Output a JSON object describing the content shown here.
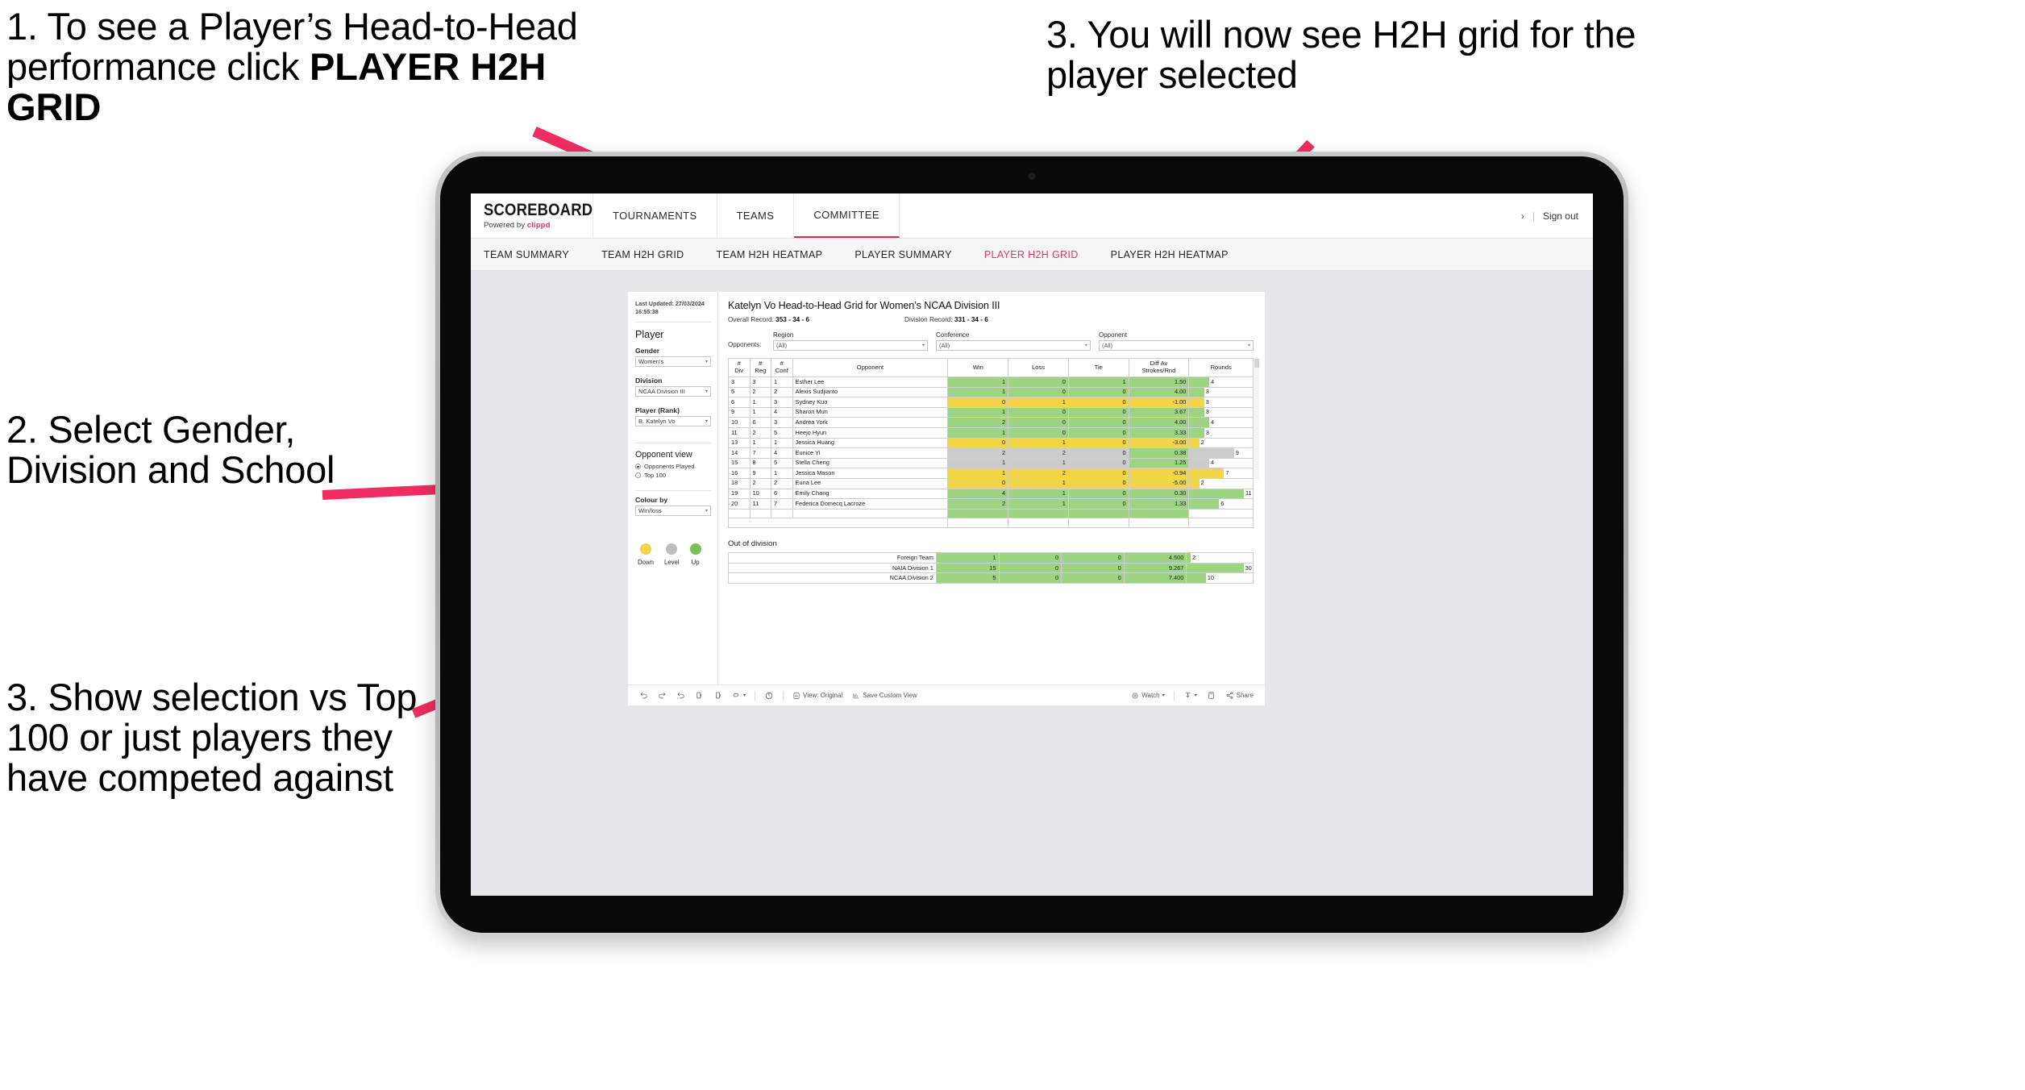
{
  "annotations": {
    "step1_plain": "1. To see a Player’s Head-to-Head performance click ",
    "step1_bold": "PLAYER H2H GRID",
    "step2": "3. You will now see H2H grid for the player selected",
    "step3": "2. Select Gender, Division and School",
    "step4": "3. Show selection vs Top 100 or just players they have competed against"
  },
  "brand": {
    "name": "SCOREBOARD",
    "powered_prefix": "Powered by ",
    "powered_name": "clippd"
  },
  "topnav": {
    "items": [
      {
        "label": "TOURNAMENTS",
        "active": false
      },
      {
        "label": "TEAMS",
        "active": false
      },
      {
        "label": "COMMITTEE",
        "active": true
      }
    ],
    "chevron": "›",
    "separator": "|",
    "sign_out": "Sign out"
  },
  "subnav": {
    "items": [
      {
        "label": "TEAM SUMMARY",
        "active": false
      },
      {
        "label": "TEAM H2H GRID",
        "active": false
      },
      {
        "label": "TEAM H2H HEATMAP",
        "active": false
      },
      {
        "label": "PLAYER SUMMARY",
        "active": false
      },
      {
        "label": "PLAYER H2H GRID",
        "active": true
      },
      {
        "label": "PLAYER H2H HEATMAP",
        "active": false
      }
    ],
    "active_color": "#e8336d"
  },
  "sidebar": {
    "last_updated": "Last Updated: 27/03/2024 16:55:38",
    "player_heading": "Player",
    "gender": {
      "label": "Gender",
      "value": "Women's"
    },
    "division": {
      "label": "Division",
      "value": "NCAA Division III"
    },
    "player_rank": {
      "label": "Player (Rank)",
      "value": "B. Katelyn Vo"
    },
    "opponent_view": {
      "heading": "Opponent view",
      "options": [
        {
          "label": "Opponents Played",
          "selected": true
        },
        {
          "label": "Top 100",
          "selected": false
        }
      ]
    },
    "colour_by": {
      "label": "Colour by",
      "value": "Win/loss"
    },
    "legend": [
      {
        "label": "Down",
        "color": "#f2d449"
      },
      {
        "label": "Level",
        "color": "#bdbdbd"
      },
      {
        "label": "Up",
        "color": "#76c151"
      }
    ]
  },
  "main": {
    "title": "Katelyn Vo Head-to-Head Grid for Women’s NCAA Division III",
    "overall_record_label": "Overall Record: ",
    "overall_record_value": "353 - 34 - 6",
    "division_record_label": "Division Record: ",
    "division_record_value": "331 - 34 - 6",
    "opponents_label": "Opponents:",
    "filters": [
      {
        "label": "Region",
        "value": "(All)"
      },
      {
        "label": "Conference",
        "value": "(All)"
      },
      {
        "label": "Opponent",
        "value": "(All)"
      }
    ],
    "out_of_division_title": "Out of division"
  },
  "chart_data": {
    "type": "table",
    "title": "Katelyn Vo Head-to-Head Grid for Women’s NCAA Division III",
    "columns": [
      "# Div",
      "# Reg",
      "# Conf",
      "Opponent",
      "Win",
      "Loss",
      "Tie",
      "Diff Av Strokes/Rnd",
      "Rounds"
    ],
    "column_headers_multiline": [
      {
        "line1": "#",
        "line2": "Div"
      },
      {
        "line1": "#",
        "line2": "Reg"
      },
      {
        "line1": "#",
        "line2": "Conf"
      },
      {
        "line1": "Opponent",
        "line2": ""
      },
      {
        "line1": "Win",
        "line2": ""
      },
      {
        "line1": "Loss",
        "line2": ""
      },
      {
        "line1": "Tie",
        "line2": ""
      },
      {
        "line1": "Diff Av",
        "line2": "Strokes/Rnd"
      },
      {
        "line1": "Rounds",
        "line2": ""
      }
    ],
    "rounds_max": 11,
    "rows": [
      {
        "div": "3",
        "reg": "3",
        "conf": "1",
        "opponent": "Esther Lee",
        "win": "1",
        "loss": "0",
        "tie": "1",
        "diff": "1.50",
        "rounds": 4,
        "state": "win"
      },
      {
        "div": "5",
        "reg": "2",
        "conf": "2",
        "opponent": "Alexis Sudjianto",
        "win": "1",
        "loss": "0",
        "tie": "0",
        "diff": "4.00",
        "rounds": 3,
        "state": "win"
      },
      {
        "div": "6",
        "reg": "1",
        "conf": "3",
        "opponent": "Sydney Kuo",
        "win": "0",
        "loss": "1",
        "tie": "0",
        "diff": "-1.00",
        "rounds": 3,
        "state": "loss"
      },
      {
        "div": "9",
        "reg": "1",
        "conf": "4",
        "opponent": "Sharon Mun",
        "win": "1",
        "loss": "0",
        "tie": "0",
        "diff": "3.67",
        "rounds": 3,
        "state": "win"
      },
      {
        "div": "10",
        "reg": "6",
        "conf": "3",
        "opponent": "Andrea York",
        "win": "2",
        "loss": "0",
        "tie": "0",
        "diff": "4.00",
        "rounds": 4,
        "state": "win"
      },
      {
        "div": "11",
        "reg": "2",
        "conf": "5",
        "opponent": "Heejo Hyun",
        "win": "1",
        "loss": "0",
        "tie": "0",
        "diff": "3.33",
        "rounds": 3,
        "state": "win"
      },
      {
        "div": "13",
        "reg": "1",
        "conf": "1",
        "opponent": "Jessica Huang",
        "win": "0",
        "loss": "1",
        "tie": "0",
        "diff": "-3.00",
        "rounds": 2,
        "state": "loss"
      },
      {
        "div": "14",
        "reg": "7",
        "conf": "4",
        "opponent": "Eunice Yi",
        "win": "2",
        "loss": "2",
        "tie": "0",
        "diff": "0.38",
        "rounds": 9,
        "state": "level"
      },
      {
        "div": "15",
        "reg": "8",
        "conf": "5",
        "opponent": "Stella Cheng",
        "win": "1",
        "loss": "1",
        "tie": "0",
        "diff": "1.25",
        "rounds": 4,
        "state": "level"
      },
      {
        "div": "16",
        "reg": "9",
        "conf": "1",
        "opponent": "Jessica Mason",
        "win": "1",
        "loss": "2",
        "tie": "0",
        "diff": "-0.94",
        "rounds": 7,
        "state": "loss"
      },
      {
        "div": "18",
        "reg": "2",
        "conf": "2",
        "opponent": "Euna Lee",
        "win": "0",
        "loss": "1",
        "tie": "0",
        "diff": "-5.00",
        "rounds": 2,
        "state": "loss"
      },
      {
        "div": "19",
        "reg": "10",
        "conf": "6",
        "opponent": "Emily Chang",
        "win": "4",
        "loss": "1",
        "tie": "0",
        "diff": "0.30",
        "rounds": 11,
        "state": "win"
      },
      {
        "div": "20",
        "reg": "11",
        "conf": "7",
        "opponent": "Federica Domecq Lacroze",
        "win": "2",
        "loss": "1",
        "tie": "0",
        "diff": "1.33",
        "rounds": 6,
        "state": "win"
      }
    ],
    "diff_cells_note": "Diff Av Strokes/Rnd cell is green when positive, yellow when negative",
    "out_of_division": {
      "rounds_max": 30,
      "rows": [
        {
          "name": "Foreign Team",
          "win": "1",
          "loss": "0",
          "tie": "0",
          "diff": "4.500",
          "rounds": 2,
          "state": "win"
        },
        {
          "name": "NAIA Division 1",
          "win": "15",
          "loss": "0",
          "tie": "0",
          "diff": "9.267",
          "rounds": 30,
          "state": "win"
        },
        {
          "name": "NCAA Division 2",
          "win": "5",
          "loss": "0",
          "tie": "0",
          "diff": "7.400",
          "rounds": 10,
          "state": "win"
        }
      ]
    }
  },
  "vizbar": {
    "view_label": "View: Original",
    "save_label": "Save Custom View",
    "watch_label": "Watch",
    "share_label": "Share",
    "caret": "▾"
  }
}
